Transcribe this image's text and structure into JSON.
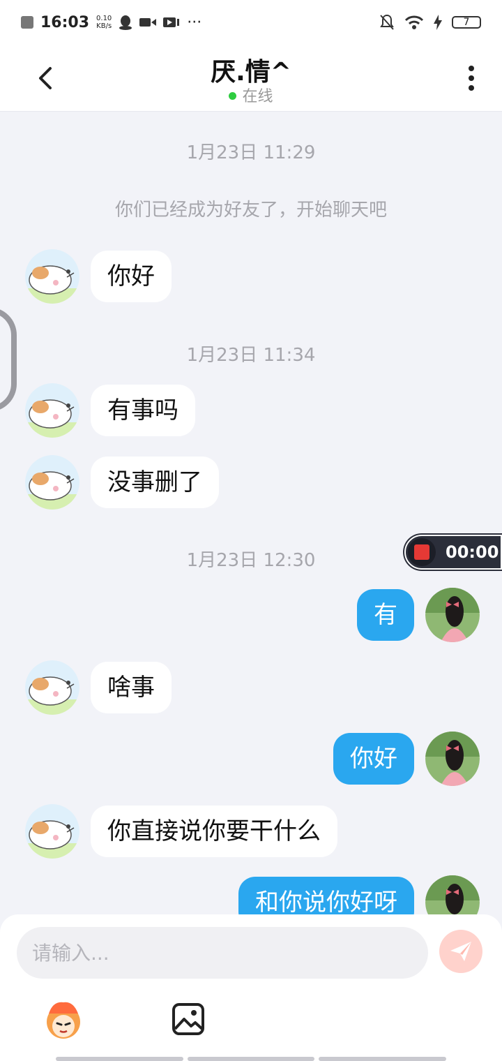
{
  "status_bar": {
    "time": "16:03",
    "net_speed_value": "0.10",
    "net_speed_unit": "KB/s",
    "dots": "···",
    "battery": "7"
  },
  "header": {
    "title": "厌.情^",
    "status_text": "在线",
    "status_color": "#2ecc40"
  },
  "chat": {
    "time_1": "1月23日 11:29",
    "system_notice": "你们已经成为好友了，开始聊天吧",
    "msg_1": "你好",
    "time_2": "1月23日 11:34",
    "msg_2": "有事吗",
    "msg_3": "没事删了",
    "time_3": "1月23日 12:30",
    "msg_4": "有",
    "msg_5": "啥事",
    "msg_6": "你好",
    "msg_7": "你直接说你要干什么",
    "msg_8": "和你说你好呀"
  },
  "recorder": {
    "time": "00:00",
    "stop_color": "#e53935"
  },
  "input": {
    "placeholder": "请输入..."
  },
  "icons": {
    "back": "back-arrow-icon",
    "more": "more-vertical-icon",
    "send": "send-icon",
    "emoji": "emoji-icon",
    "image": "image-icon"
  },
  "colors": {
    "sent_bubble": "#2aa7ef",
    "received_bubble": "#ffffff",
    "background": "#f2f3f8"
  }
}
